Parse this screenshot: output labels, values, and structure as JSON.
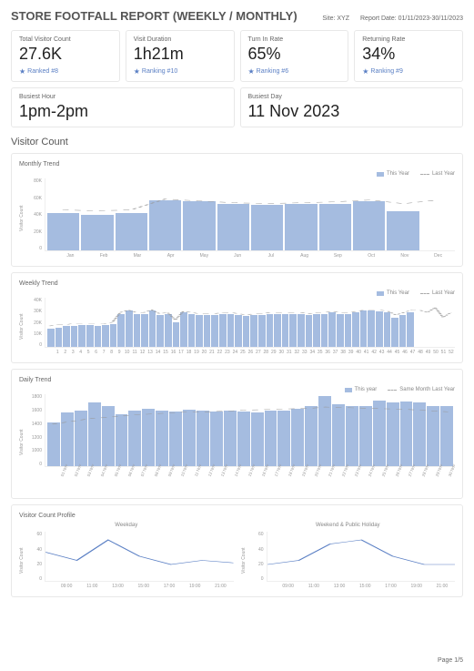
{
  "header": {
    "title": "STORE FOOTFALL REPORT (WEEKLY / MONTHLY)",
    "site_label": "Site: XYZ",
    "report_date_label": "Report Date: 01/11/2023-30/11/2023"
  },
  "kpis": [
    {
      "label": "Total Visitor Count",
      "value": "27.6K",
      "rank": "Ranked #8"
    },
    {
      "label": "Visit Duration",
      "value": "1h21m",
      "rank": "Ranking #10"
    },
    {
      "label": "Turn In Rate",
      "value": "65%",
      "rank": "Ranking #6"
    },
    {
      "label": "Returning Rate",
      "value": "34%",
      "rank": "Ranking #9"
    }
  ],
  "busiest": [
    {
      "label": "Busiest Hour",
      "value": "1pm-2pm"
    },
    {
      "label": "Busiest Day",
      "value": "11 Nov 2023"
    }
  ],
  "section_title": "Visitor Count",
  "legends": {
    "this_year": "This Year",
    "last_year": "Last Year",
    "this_year_lc": "This year",
    "same_month_last_year": "Same Month Last Year"
  },
  "footer": {
    "page": "Page 1/5"
  },
  "chart_data": [
    {
      "type": "bar",
      "title": "Monthly Trend",
      "ylabel": "Visitor Count",
      "ylim": [
        0,
        80000
      ],
      "yticks": [
        "0",
        "20K",
        "40K",
        "60K",
        "80K"
      ],
      "categories": [
        "Jan",
        "Feb",
        "Mar",
        "Apr",
        "May",
        "Jun",
        "Jul",
        "Aug",
        "Sep",
        "Oct",
        "Nov",
        "Dec"
      ],
      "values": [
        42000,
        40000,
        42000,
        56000,
        55000,
        52000,
        51000,
        52000,
        52000,
        55000,
        44000,
        0
      ],
      "series": [
        {
          "name": "This Year",
          "values": [
            42000,
            40000,
            42000,
            56000,
            55000,
            52000,
            51000,
            52000,
            52000,
            55000,
            44000,
            0
          ]
        },
        {
          "name": "Last Year",
          "values": [
            45000,
            44000,
            45000,
            57000,
            55000,
            53000,
            52000,
            53000,
            54000,
            56000,
            52000,
            56000
          ]
        }
      ]
    },
    {
      "type": "bar",
      "title": "Weekly Trend",
      "ylabel": "Visitor Count",
      "ylim": [
        0,
        40000
      ],
      "yticks": [
        "0",
        "10K",
        "20K",
        "30K",
        "40K"
      ],
      "categories": [
        "1",
        "2",
        "3",
        "4",
        "5",
        "6",
        "7",
        "8",
        "9",
        "10",
        "11",
        "12",
        "13",
        "14",
        "15",
        "16",
        "17",
        "18",
        "19",
        "20",
        "21",
        "22",
        "23",
        "24",
        "25",
        "26",
        "27",
        "28",
        "29",
        "30",
        "31",
        "32",
        "33",
        "34",
        "35",
        "36",
        "37",
        "38",
        "39",
        "40",
        "41",
        "42",
        "43",
        "44",
        "45",
        "46",
        "47",
        "48",
        "49",
        "50",
        "51",
        "52"
      ],
      "values": [
        15000,
        16000,
        17000,
        17000,
        18000,
        18000,
        17000,
        18000,
        19000,
        27000,
        30000,
        27000,
        27000,
        30000,
        26000,
        27000,
        20000,
        28000,
        27000,
        26000,
        26000,
        26000,
        27000,
        27000,
        26000,
        25000,
        26000,
        26000,
        27000,
        27000,
        27000,
        27000,
        27000,
        26000,
        27000,
        27000,
        28000,
        27000,
        27000,
        28000,
        30000,
        30000,
        29000,
        28000,
        24000,
        26000,
        28000,
        0,
        0,
        0,
        0,
        0
      ],
      "series": [
        {
          "name": "This Year",
          "values": [
            15000,
            16000,
            17000,
            17000,
            18000,
            18000,
            17000,
            18000,
            19000,
            27000,
            30000,
            27000,
            27000,
            30000,
            26000,
            27000,
            20000,
            28000,
            27000,
            26000,
            26000,
            26000,
            27000,
            27000,
            26000,
            25000,
            26000,
            26000,
            27000,
            27000,
            27000,
            27000,
            27000,
            26000,
            27000,
            27000,
            28000,
            27000,
            27000,
            28000,
            30000,
            30000,
            29000,
            28000,
            24000,
            26000,
            28000,
            0,
            0,
            0,
            0,
            0
          ]
        },
        {
          "name": "Last Year",
          "values": [
            17000,
            18000,
            18000,
            19000,
            19000,
            19000,
            19000,
            19000,
            20000,
            28000,
            30000,
            28000,
            28000,
            30000,
            27000,
            28000,
            22000,
            29000,
            28000,
            27000,
            27000,
            27000,
            28000,
            28000,
            27000,
            26000,
            27000,
            27000,
            28000,
            28000,
            28000,
            28000,
            28000,
            27000,
            28000,
            28000,
            29000,
            28000,
            28000,
            29000,
            30000,
            30000,
            30000,
            29000,
            26000,
            28000,
            30000,
            30000,
            28000,
            32000,
            24000,
            28000
          ]
        }
      ]
    },
    {
      "type": "bar",
      "title": "Daily Trend",
      "ylabel": "Visitor Count",
      "ylim": [
        0,
        1800
      ],
      "yticks": [
        "0",
        "1000",
        "1200",
        "1400",
        "1600",
        "1800"
      ],
      "categories": [
        "01 Nov",
        "02 Nov",
        "03 Nov",
        "04 Nov",
        "05 Nov",
        "06 Nov",
        "07 Nov",
        "08 Nov",
        "09 Nov",
        "10 Nov",
        "11 Nov",
        "12 Nov",
        "13 Nov",
        "14 Nov",
        "15 Nov",
        "16 Nov",
        "17 Nov",
        "18 Nov",
        "19 Nov",
        "20 Nov",
        "21 Nov",
        "22 Nov",
        "23 Nov",
        "24 Nov",
        "25 Nov",
        "26 Nov",
        "27 Nov",
        "28 Nov",
        "29 Nov",
        "30 Nov"
      ],
      "values": [
        1100,
        1350,
        1400,
        1600,
        1500,
        1300,
        1400,
        1450,
        1400,
        1380,
        1420,
        1400,
        1380,
        1400,
        1380,
        1350,
        1400,
        1400,
        1450,
        1500,
        1750,
        1550,
        1500,
        1500,
        1650,
        1600,
        1630,
        1600,
        1500,
        1500
      ],
      "series": [
        {
          "name": "This year",
          "values": [
            1100,
            1350,
            1400,
            1600,
            1500,
            1300,
            1400,
            1450,
            1400,
            1380,
            1420,
            1400,
            1380,
            1400,
            1380,
            1350,
            1400,
            1400,
            1450,
            1500,
            1750,
            1550,
            1500,
            1500,
            1650,
            1600,
            1630,
            1600,
            1500,
            1500
          ]
        },
        {
          "name": "Same Month Last Year",
          "values": [
            1050,
            1100,
            1150,
            1200,
            1220,
            1250,
            1280,
            1300,
            1320,
            1340,
            1360,
            1350,
            1370,
            1380,
            1400,
            1410,
            1420,
            1430,
            1440,
            1450,
            1480,
            1470,
            1460,
            1450,
            1440,
            1430,
            1420,
            1400,
            1380,
            1360
          ]
        }
      ]
    },
    {
      "type": "line",
      "title": "Visitor Count Profile",
      "subcharts": [
        {
          "name": "Weekday",
          "ylabel": "Visitor Count",
          "ylim": [
            0,
            60
          ],
          "yticks": [
            "0",
            "20",
            "40",
            "60"
          ],
          "categories": [
            "09:00",
            "11:00",
            "13:00",
            "15:00",
            "17:00",
            "19:00",
            "21:00"
          ],
          "values": [
            35,
            25,
            50,
            30,
            20,
            25,
            22
          ]
        },
        {
          "name": "Weekend & Public Holiday",
          "ylabel": "Visitor Count",
          "ylim": [
            0,
            60
          ],
          "yticks": [
            "0",
            "20",
            "40",
            "60"
          ],
          "categories": [
            "09:00",
            "11:00",
            "13:00",
            "15:00",
            "17:00",
            "19:00",
            "21:00"
          ],
          "values": [
            20,
            25,
            45,
            50,
            30,
            20,
            20
          ]
        }
      ]
    }
  ]
}
